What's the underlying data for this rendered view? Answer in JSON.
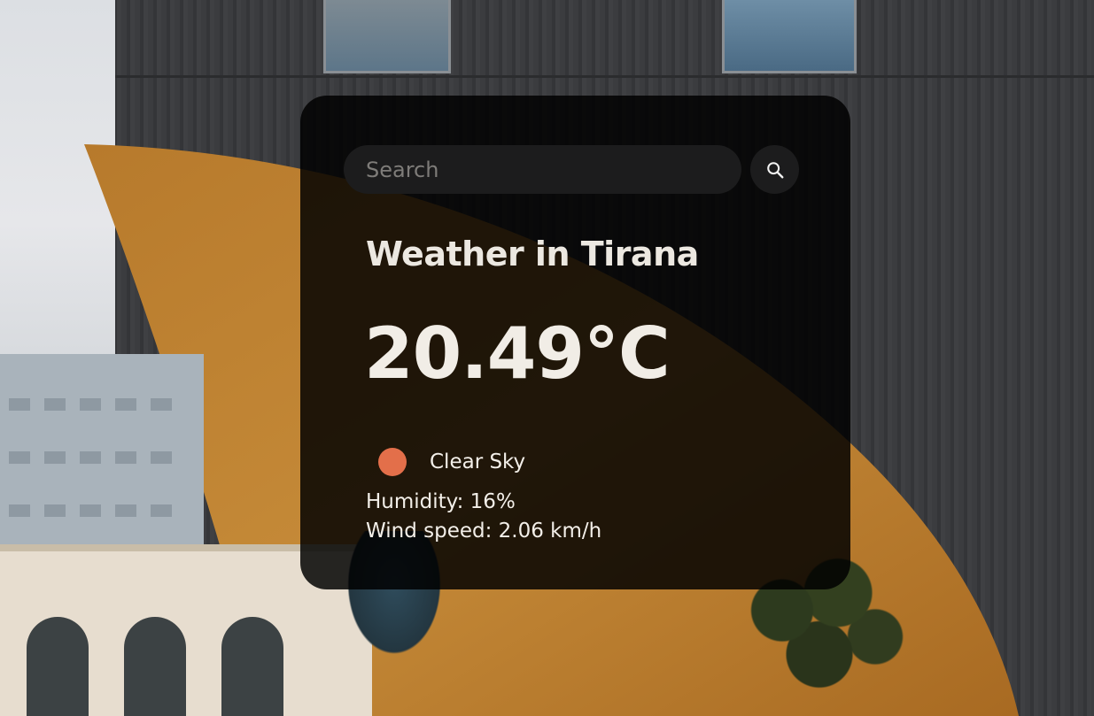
{
  "search": {
    "placeholder": "Search",
    "value": "",
    "button_icon": "search-icon"
  },
  "weather": {
    "title": "Weather in Tirana",
    "temperature": "20.49°C",
    "condition": {
      "icon": "clear-sky-sun-icon",
      "icon_color": "#e36f4a",
      "description": "Clear Sky"
    },
    "humidity_text": "Humidity: 16%",
    "wind_text": "Wind speed: 2.06 km/h"
  },
  "theme": {
    "card_background": "rgba(0,0,0,0.84)",
    "input_background": "#1c1c1d",
    "text_color": "#f3efe9"
  }
}
